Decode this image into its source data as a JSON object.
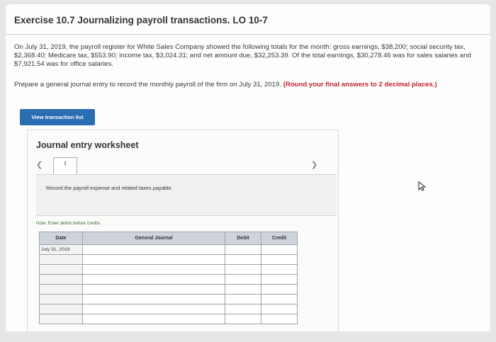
{
  "header": {
    "title": "Exercise 10.7 Journalizing payroll transactions. LO 10-7"
  },
  "problem": {
    "text": "On July 31, 2019, the payroll register for White Sales Company showed the following totals for the month: gross earnings, $38,200; social security tax, $2,368.40; Medicare tax, $553.90; income tax, $3,024.31; and net amount due, $32,253.39. Of the total earnings, $30,278.46 was for sales salaries and $7,921.54 was for office salaries.",
    "instruction": "Prepare a general journal entry to record the monthly payroll of the firm on July 31, 2019.",
    "rounding_note": "(Round your final answers to 2 decimal places.)"
  },
  "buttons": {
    "view_transaction_list": "View transaction list"
  },
  "worksheet": {
    "title": "Journal entry worksheet",
    "prev_icon": "chevron-left-icon",
    "next_icon": "chevron-right-icon",
    "step_number": "1",
    "instruction": "Record the payroll expense and related taxes payable.",
    "note": "Note: Enter debits before credits."
  },
  "journal_table": {
    "columns": [
      "Date",
      "General Journal",
      "Debit",
      "Credit"
    ],
    "rows": [
      {
        "date": "July 31, 2019",
        "account": "",
        "debit": "",
        "credit": ""
      },
      {
        "date": "",
        "account": "",
        "debit": "",
        "credit": ""
      },
      {
        "date": "",
        "account": "",
        "debit": "",
        "credit": ""
      },
      {
        "date": "",
        "account": "",
        "debit": "",
        "credit": ""
      },
      {
        "date": "",
        "account": "",
        "debit": "",
        "credit": ""
      },
      {
        "date": "",
        "account": "",
        "debit": "",
        "credit": ""
      },
      {
        "date": "",
        "account": "",
        "debit": "",
        "credit": ""
      },
      {
        "date": "",
        "account": "",
        "debit": "",
        "credit": ""
      }
    ]
  },
  "colors": {
    "accent": "#2a6db3",
    "warning_text": "#c0252f",
    "table_header": "#cfd4da"
  }
}
